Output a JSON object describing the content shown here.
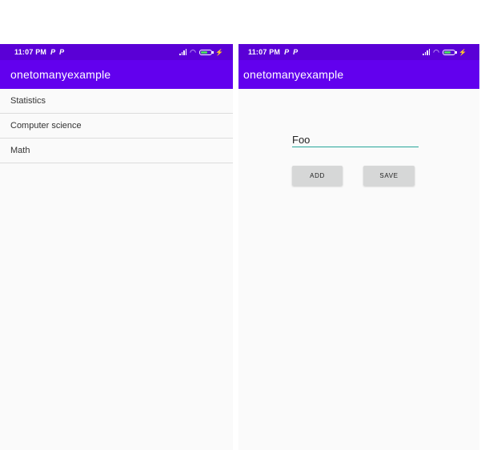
{
  "left_screen": {
    "status_bar": {
      "time": "11:07 PM",
      "p1": "P",
      "p2": "P"
    },
    "app_bar": {
      "title": "onetomanyexample"
    },
    "list": {
      "items": [
        {
          "label": "Statistics"
        },
        {
          "label": "Computer science"
        },
        {
          "label": "Math"
        }
      ]
    }
  },
  "right_screen": {
    "status_bar": {
      "time": "11:07 PM",
      "p1": "P",
      "p2": "P"
    },
    "app_bar": {
      "title": "onetomanyexample"
    },
    "form": {
      "input_value": "Foo",
      "add_label": "ADD",
      "save_label": "SAVE"
    }
  },
  "colors": {
    "status_bar": "#5a00d6",
    "app_bar": "#6200ee",
    "input_underline": "#26a69a",
    "button_bg": "#d6d7d7"
  },
  "icons": [
    "signal-icon",
    "wifi-icon",
    "battery-icon",
    "charging-bolt-icon"
  ]
}
